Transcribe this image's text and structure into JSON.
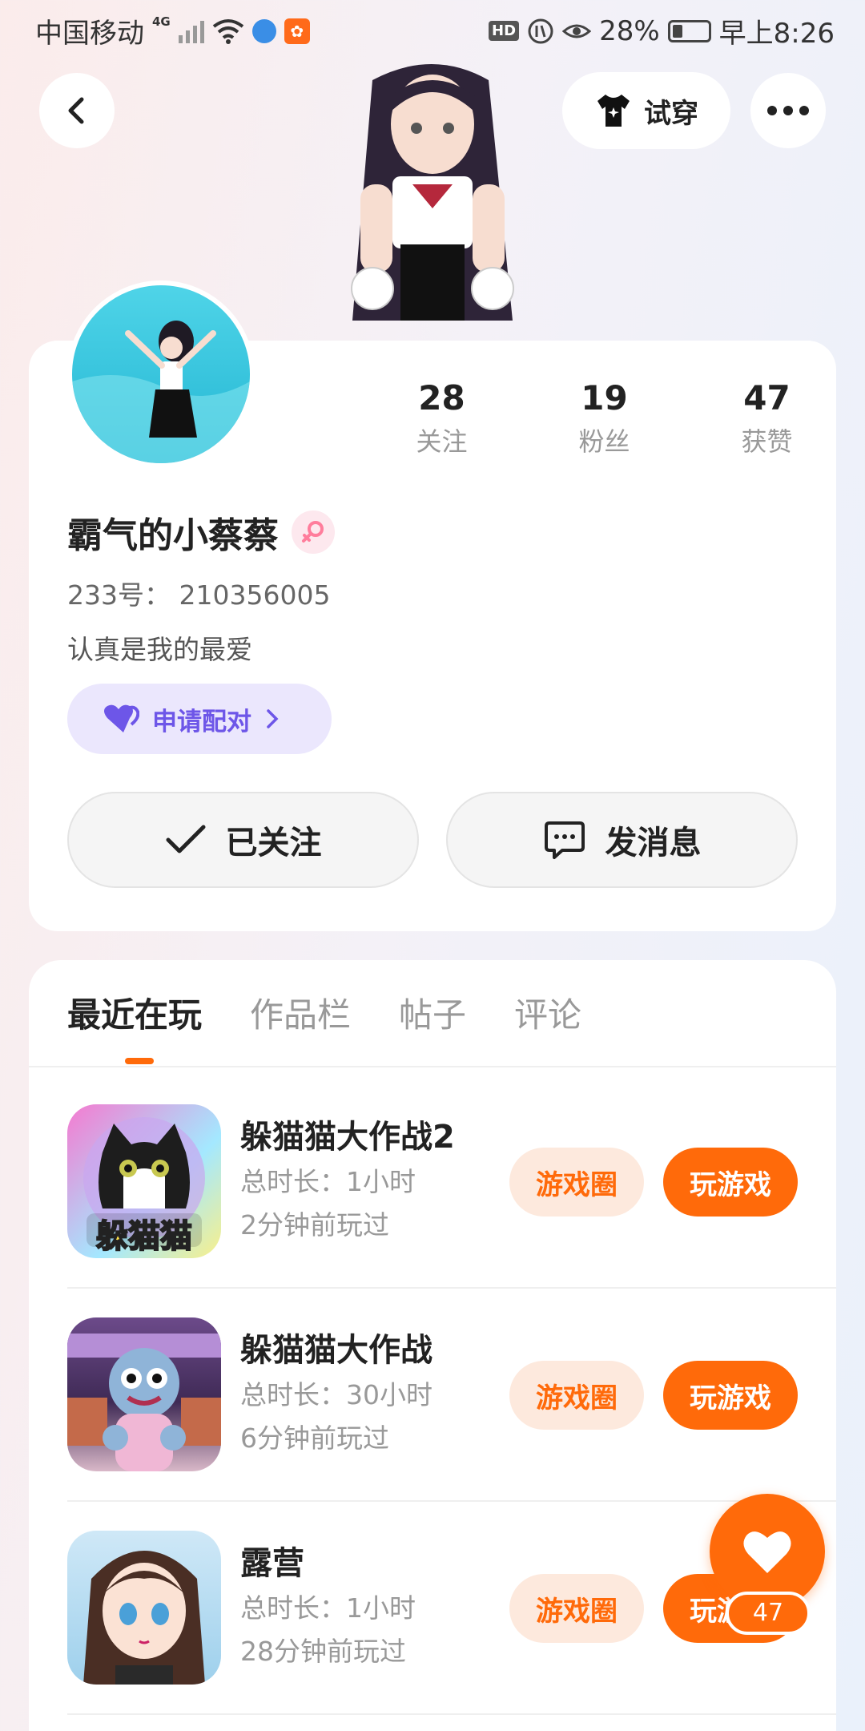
{
  "status_bar": {
    "carrier": "中国移动",
    "network": "4G",
    "battery": "28%",
    "time": "早上8:26",
    "hd": "HD"
  },
  "nav": {
    "back_icon": "chevron-left-icon",
    "try_on_label": "试穿",
    "more_icon": "more-horizontal-icon"
  },
  "profile": {
    "stats": [
      {
        "value": "28",
        "label": "关注"
      },
      {
        "value": "19",
        "label": "粉丝"
      },
      {
        "value": "47",
        "label": "获赞"
      }
    ],
    "username": "霸气的小蔡蔡",
    "gender_icon": "female-symbol-icon",
    "uid": "233号： 210356005",
    "bio": "认真是我的最爱",
    "pair_label": "申请配对",
    "follow_label": "已关注",
    "message_label": "发消息"
  },
  "tabs": [
    {
      "label": "最近在玩",
      "active": true
    },
    {
      "label": "作品栏",
      "active": false
    },
    {
      "label": "帖子",
      "active": false
    },
    {
      "label": "评论",
      "active": false
    }
  ],
  "games": [
    {
      "name": "躲猫猫大作战2",
      "duration": "总时长：1小时",
      "last_played": "2分钟前玩过",
      "icon_text": "躲猫猫",
      "circle_label": "游戏圈",
      "play_label": "玩游戏"
    },
    {
      "name": "躲猫猫大作战",
      "duration": "总时长：30小时",
      "last_played": "6分钟前玩过",
      "circle_label": "游戏圈",
      "play_label": "玩游戏"
    },
    {
      "name": "露营",
      "duration": "总时长：1小时",
      "last_played": "28分钟前玩过",
      "circle_label": "游戏圈",
      "play_label": "玩游戏"
    }
  ],
  "like_fab": {
    "count": "47",
    "icon": "heart-icon"
  },
  "colors": {
    "accent": "#ff6a0a",
    "pair_purple": "#6d56e8"
  }
}
